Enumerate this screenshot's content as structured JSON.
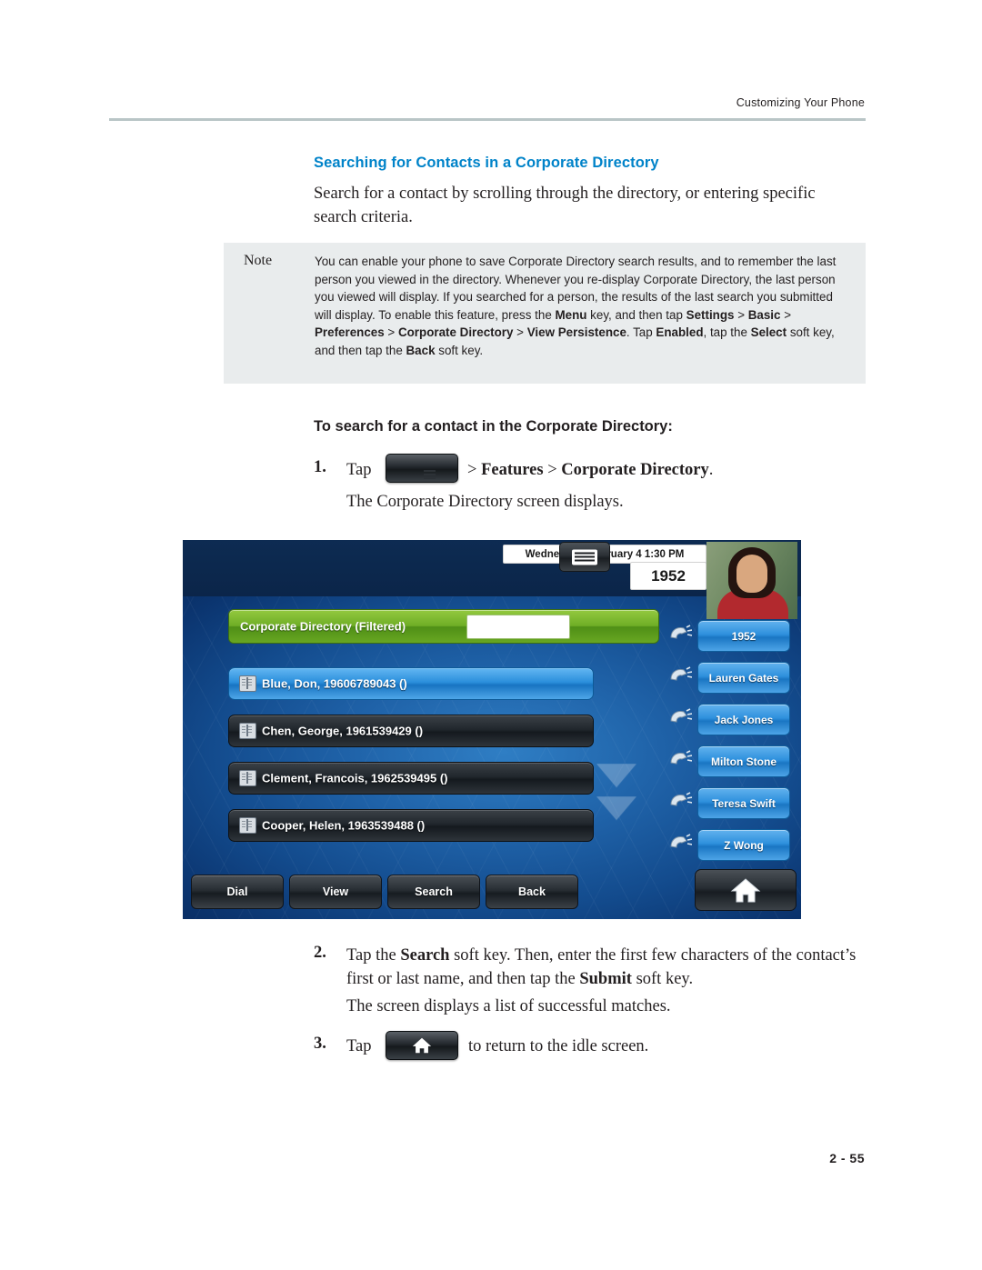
{
  "header": {
    "running_head": "Customizing Your Phone"
  },
  "section": {
    "heading": "Searching for Contacts in a Corporate Directory",
    "intro": "Search for a contact by scrolling through the directory, or entering specific search criteria."
  },
  "note": {
    "label": "Note",
    "body_html": "You can enable your phone to save Corporate Directory search results, and to remember the last person you viewed in the directory. Whenever you re-display Corporate Directory, the last person you viewed will display. If you searched for a person, the results of the last search you submitted will display. To enable this feature, press the <b>Menu</b> key, and then tap <b>Settings</b> &gt; <b>Basic</b> &gt; <b>Preferences</b> &gt; <b>Corporate Directory</b> &gt; <b>View Persistence</b>. Tap <b>Enabled</b>, tap the <b>Select</b> soft key, and then tap the <b>Back</b> soft key."
  },
  "procedure": {
    "heading": "To search for a contact in the Corporate Directory:",
    "steps": [
      {
        "number": "1.",
        "lead": "Tap",
        "icon": "menu-key-icon",
        "text_html": "&gt; <b>Features</b> &gt; <b>Corporate Directory</b>.",
        "followup": "The Corporate Directory screen displays."
      },
      {
        "number": "2.",
        "text_html": "Tap the <b>Search</b> soft key. Then, enter the first few characters of the contact’s first or last name, and then tap the <b>Submit</b> soft key.",
        "followup": "The screen displays a list of successful matches."
      },
      {
        "number": "3.",
        "lead": "Tap",
        "icon": "home-key-icon",
        "text_html": "to return to the idle screen."
      }
    ]
  },
  "phone_screen": {
    "status_line": "Wednesday, February 4  1:30 PM",
    "extension": "1952",
    "title_bar": {
      "label": "Corporate Directory (Filtered)",
      "search_value": "",
      "keyboard_icon": "keyboard-icon"
    },
    "entries": [
      {
        "name": "Blue, Don,",
        "number": "19606789043 ()",
        "selected": true
      },
      {
        "name": "Chen, George,",
        "number": "1961539429 ()",
        "selected": false
      },
      {
        "name": "Clement, Francois,",
        "number": "1962539495 ()",
        "selected": false
      },
      {
        "name": "Cooper, Helen,",
        "number": "1963539488 ()",
        "selected": false
      }
    ],
    "line_keys": [
      "1952",
      "Lauren Gates",
      "Jack Jones",
      "Milton Stone",
      "Teresa Swift",
      "Z Wong"
    ],
    "soft_keys": [
      "Dial",
      "View",
      "Search",
      "Back"
    ],
    "home_key_icon": "home-icon"
  },
  "footer": {
    "page_number": "2 - 55"
  },
  "colors": {
    "heading_blue": "#0083C9",
    "note_bg": "#E9ECED",
    "rule": "#B9C5C6",
    "selected_entry": "#2B8FDC",
    "title_bar_green": "#6FAE26"
  }
}
